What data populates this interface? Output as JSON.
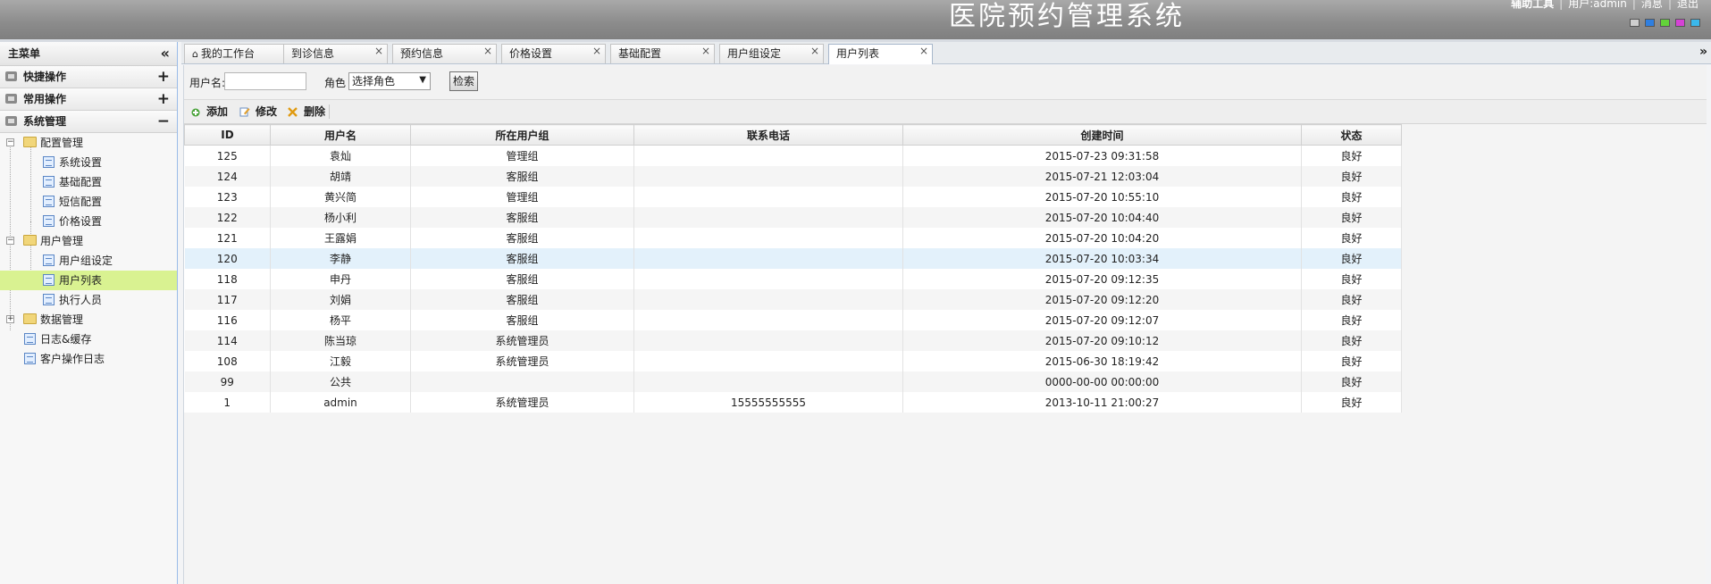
{
  "app": {
    "title": "医院预约管理系统",
    "header_links": [
      "辅助工具",
      "用户:admin",
      "消息",
      "退出"
    ],
    "theme_colors": [
      "#cfcfcf",
      "#2f7fe0",
      "#63d33a",
      "#d642d6",
      "#3bb7ea"
    ]
  },
  "sidebar": {
    "title": "主菜单",
    "collapse_icon": "double-chevron-left-icon",
    "sections": [
      {
        "label": "快捷操作",
        "toggle": "+"
      },
      {
        "label": "常用操作",
        "toggle": "+"
      },
      {
        "label": "系统管理",
        "toggle": "−"
      }
    ],
    "tree": {
      "config": {
        "label": "配置管理",
        "expander": "−",
        "items": [
          "系统设置",
          "基础配置",
          "短信配置",
          "价格设置"
        ]
      },
      "users": {
        "label": "用户管理",
        "expander": "−",
        "items": [
          "用户组设定",
          "用户列表",
          "执行人员"
        ]
      },
      "data": {
        "label": "数据管理",
        "expander": "+"
      },
      "logs": [
        "日志&缓存",
        "客户操作日志"
      ],
      "selected": "用户列表"
    }
  },
  "tabs": [
    {
      "label": "我的工作台",
      "closable": false
    },
    {
      "label": "到诊信息",
      "closable": true
    },
    {
      "label": "预约信息",
      "closable": true
    },
    {
      "label": "价格设置",
      "closable": true
    },
    {
      "label": "基础配置",
      "closable": true
    },
    {
      "label": "用户组设定",
      "closable": true
    },
    {
      "label": "用户列表",
      "closable": true,
      "active": true
    }
  ],
  "tab_close_glyph": "×",
  "tab_scroll_glyph": "»",
  "search": {
    "username_label": "用户名:",
    "username_value": "",
    "role_label": "角色",
    "role_selected": "选择角色",
    "search_button": "检索"
  },
  "toolbar": {
    "add": "添加",
    "edit": "修改",
    "delete": "删除"
  },
  "table": {
    "columns": [
      "ID",
      "用户名",
      "所在用户组",
      "联系电话",
      "创建时间",
      "状态"
    ],
    "rows": [
      [
        "125",
        "袁灿",
        "管理组",
        "",
        "2015-07-23 09:31:58",
        "良好"
      ],
      [
        "124",
        "胡靖",
        "客服组",
        "",
        "2015-07-21 12:03:04",
        "良好"
      ],
      [
        "123",
        "黄兴简",
        "管理组",
        "",
        "2015-07-20 10:55:10",
        "良好"
      ],
      [
        "122",
        "杨小利",
        "客服组",
        "",
        "2015-07-20 10:04:40",
        "良好"
      ],
      [
        "121",
        "王露娟",
        "客服组",
        "",
        "2015-07-20 10:04:20",
        "良好"
      ],
      [
        "120",
        "李静",
        "客服组",
        "",
        "2015-07-20 10:03:34",
        "良好"
      ],
      [
        "118",
        "申丹",
        "客服组",
        "",
        "2015-07-20 09:12:35",
        "良好"
      ],
      [
        "117",
        "刘娟",
        "客服组",
        "",
        "2015-07-20 09:12:20",
        "良好"
      ],
      [
        "116",
        "杨平",
        "客服组",
        "",
        "2015-07-20 09:12:07",
        "良好"
      ],
      [
        "114",
        "陈当琼",
        "系统管理员",
        "",
        "2015-07-20 09:10:12",
        "良好"
      ],
      [
        "108",
        "江毅",
        "系统管理员",
        "",
        "2015-06-30 18:19:42",
        "良好"
      ],
      [
        "99",
        "公共",
        "",
        "",
        "0000-00-00 00:00:00",
        "良好"
      ],
      [
        "1",
        "admin",
        "系统管理员",
        "15555555555",
        "2013-10-11 21:00:27",
        "良好"
      ]
    ],
    "highlighted_row": 5
  }
}
